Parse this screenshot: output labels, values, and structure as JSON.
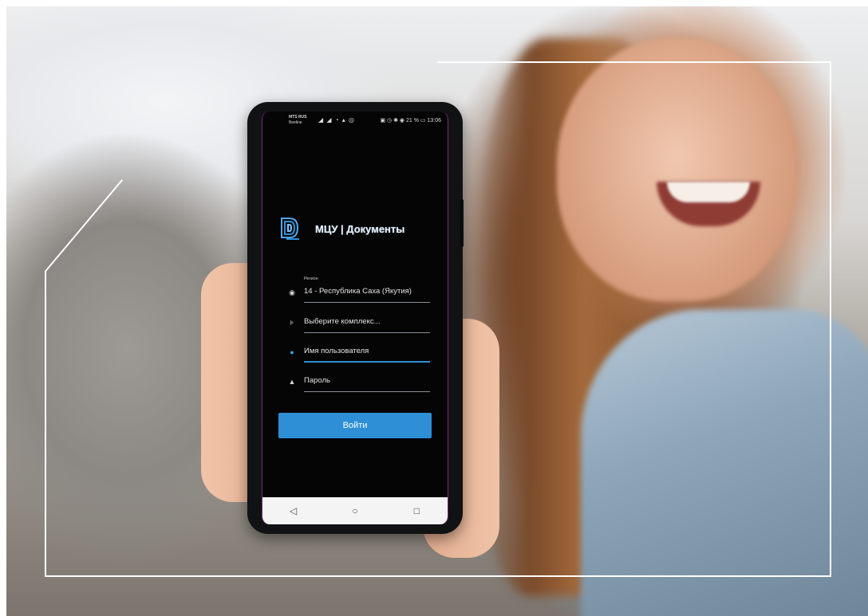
{
  "status_bar": {
    "carrier_primary": "MTS RUS",
    "carrier_secondary": "Beeline",
    "battery": "21 %",
    "time": "13:06"
  },
  "app": {
    "name": "МЦУ | Документы"
  },
  "form": {
    "region_label": "Регион",
    "region_value": "14 - Республика Саха (Якутия)",
    "complex_placeholder": "Выберите комплекс...",
    "username_placeholder": "Имя пользователя",
    "password_placeholder": "Пароль",
    "login_button": "Войти"
  },
  "nav": {
    "back": "◁",
    "home": "○",
    "recents": "□"
  },
  "colors": {
    "accent": "#2e8fd7",
    "screen_bg": "#050505"
  }
}
